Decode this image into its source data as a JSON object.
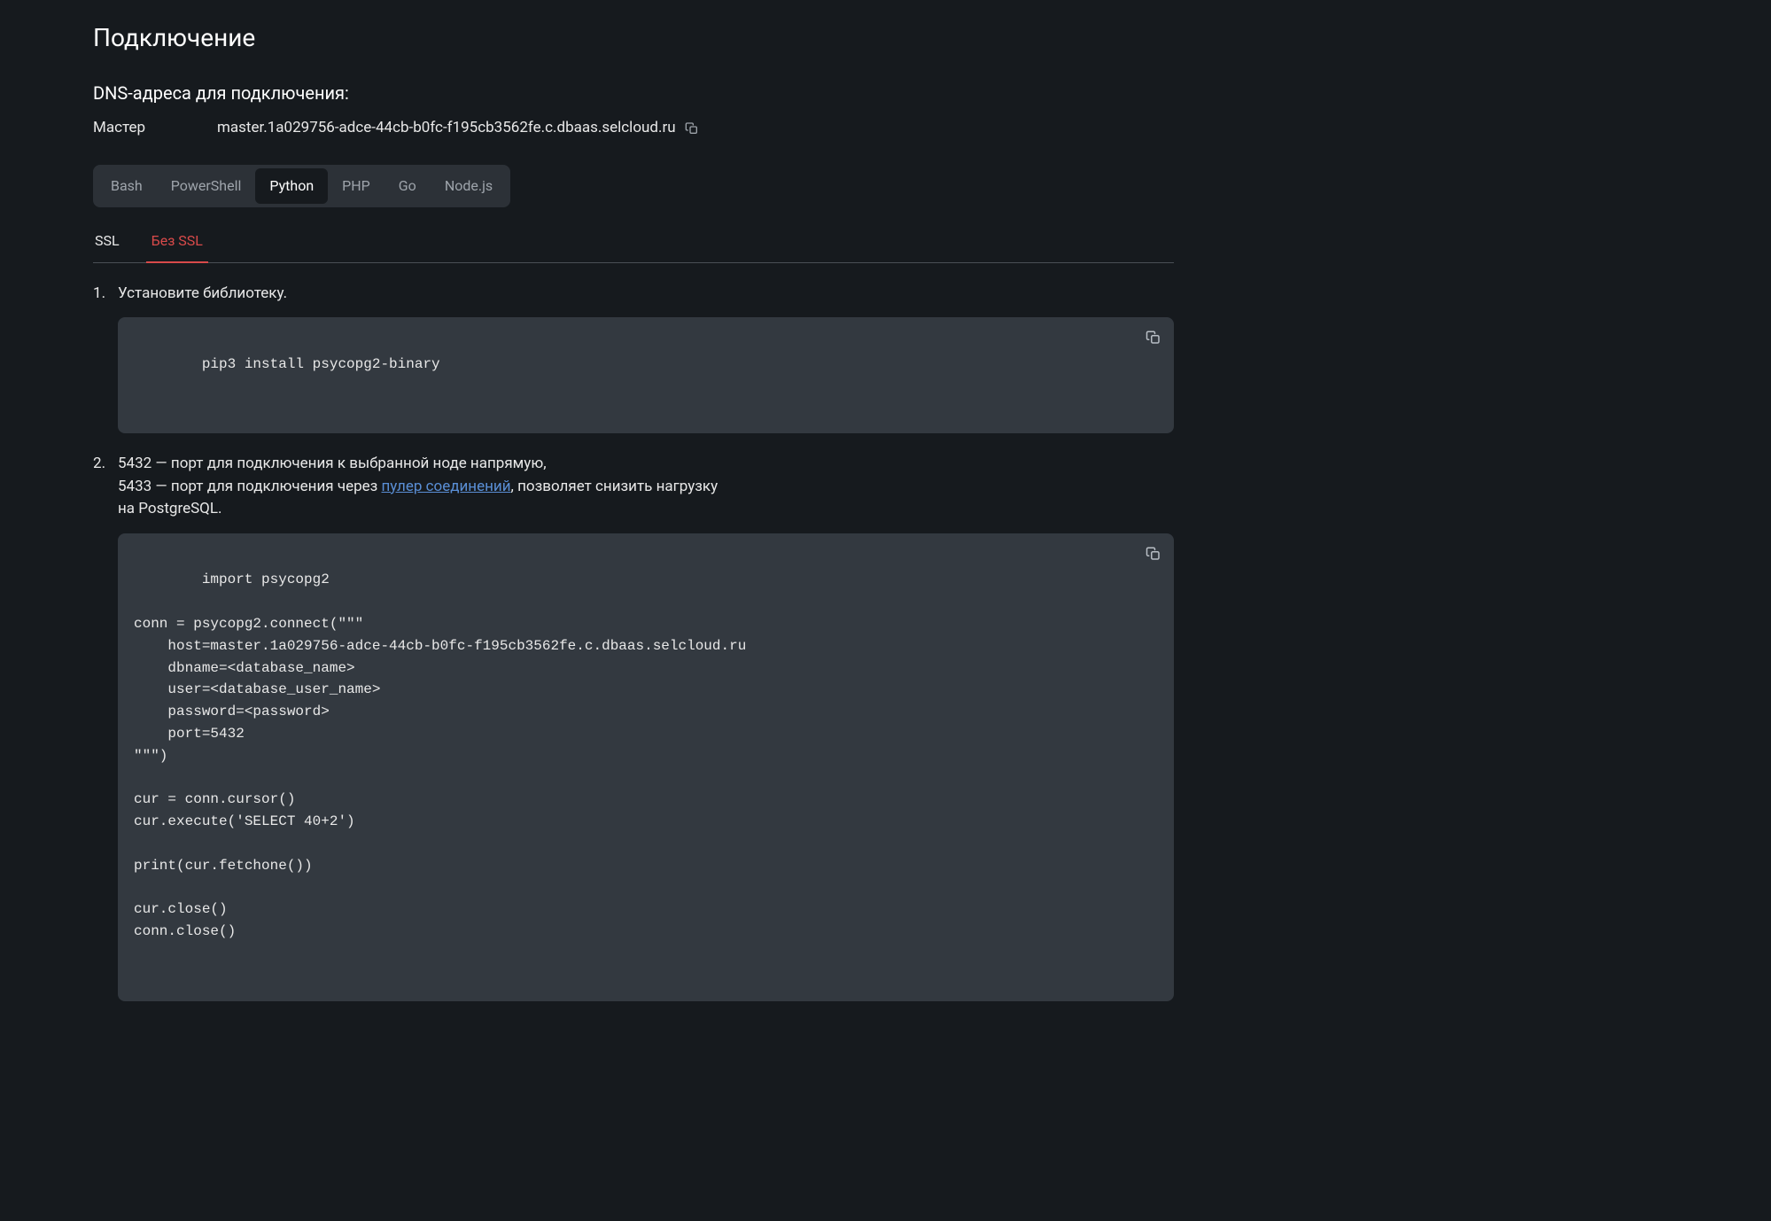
{
  "header": {
    "title": "Подключение"
  },
  "dns": {
    "heading": "DNS-адреса для подключения:",
    "label": "Мастер",
    "value": "master.1a029756-adce-44cb-b0fc-f195cb3562fe.c.dbaas.selcloud.ru"
  },
  "lang_tabs": {
    "items": [
      "Bash",
      "PowerShell",
      "Python",
      "PHP",
      "Go",
      "Node.js"
    ],
    "active": "Python"
  },
  "ssl_tabs": {
    "items": [
      "SSL",
      "Без SSL"
    ],
    "active": "Без SSL"
  },
  "steps": {
    "s1": {
      "text": "Установите библиотеку.",
      "code": "pip3 install psycopg2-binary"
    },
    "s2": {
      "line1_prefix": "5432 — порт для подключения к выбранной ноде напрямую,",
      "line2_prefix": "5433 — порт для подключения через ",
      "link_text": "пулер соединений",
      "line2_suffix": ", позволяет снизить нагрузку",
      "line3": "на PostgreSQL.",
      "code": "import psycopg2\n\nconn = psycopg2.connect(\"\"\"\n    host=master.1a029756-adce-44cb-b0fc-f195cb3562fe.c.dbaas.selcloud.ru\n    dbname=<database_name>\n    user=<database_user_name>\n    password=<password>\n    port=5432\n\"\"\")\n\ncur = conn.cursor()\ncur.execute('SELECT 40+2')\n\nprint(cur.fetchone())\n\ncur.close()\nconn.close()"
    }
  }
}
